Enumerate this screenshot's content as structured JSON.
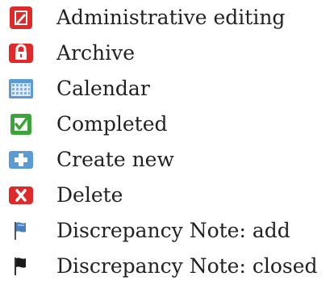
{
  "legend": {
    "items": [
      {
        "icon": "administrative-editing-icon",
        "label": "Administrative editing"
      },
      {
        "icon": "archive-lock-icon",
        "label": "Archive"
      },
      {
        "icon": "calendar-icon",
        "label": "Calendar"
      },
      {
        "icon": "completed-check-icon",
        "label": "Completed"
      },
      {
        "icon": "create-new-plus-icon",
        "label": "Create new"
      },
      {
        "icon": "delete-x-icon",
        "label": "Delete"
      },
      {
        "icon": "discrepancy-note-add-flag-icon",
        "label": "Discrepancy Note: add"
      },
      {
        "icon": "discrepancy-note-closed-flag-icon",
        "label": "Discrepancy Note: closed"
      }
    ]
  },
  "colors": {
    "red": "#e02a2a",
    "green": "#3aa63a",
    "blue": "#5b9bd5",
    "flag_blue": "#4a7fc0",
    "flag_black": "#1a1a1a",
    "text": "#222222"
  }
}
